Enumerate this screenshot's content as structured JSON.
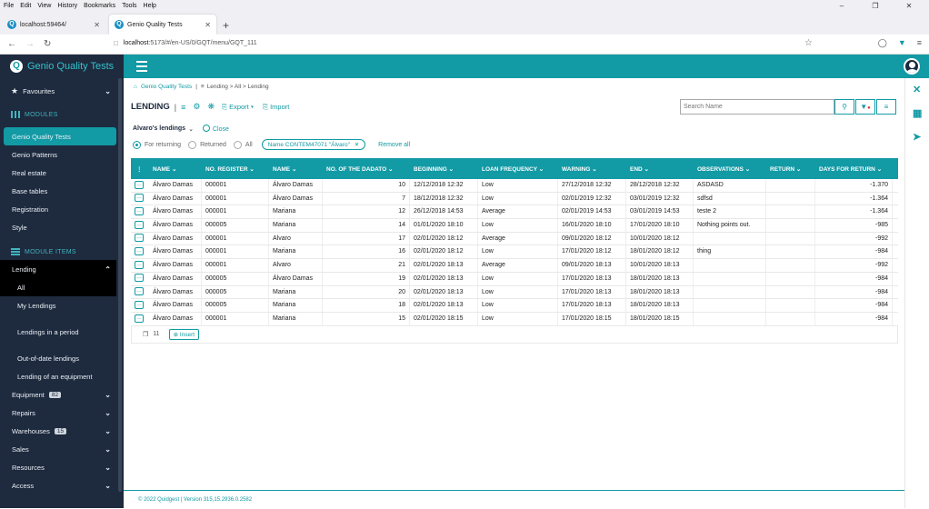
{
  "browser": {
    "menu": [
      "File",
      "Edit",
      "View",
      "History",
      "Bookmarks",
      "Tools",
      "Help"
    ],
    "tabs": [
      {
        "label": "localhost:59464/"
      },
      {
        "label": "Genio Quality Tests"
      }
    ],
    "url_host": "localhost",
    "url_rest": ":5173/#/en-US/0/GQT/menu/GQT_111"
  },
  "sidebar": {
    "brand": "Genio Quality Tests",
    "favourites": "Favourites",
    "modules_header": "MODULES",
    "modules": [
      "Genio Quality Tests",
      "Genio Patterns",
      "Real estate",
      "Base tables",
      "Registration",
      "Style"
    ],
    "module_items_header": "MODULE ITEMS",
    "lending": "Lending",
    "lending_sub": [
      "All",
      "My Lendings",
      "Lendings in a period",
      "Out-of-date lendings",
      "Lending of an equipment"
    ],
    "groups": [
      {
        "label": "Equipment",
        "badge": "82"
      },
      {
        "label": "Repairs",
        "badge": ""
      },
      {
        "label": "Warehouses",
        "badge": "15"
      },
      {
        "label": "Sales",
        "badge": ""
      },
      {
        "label": "Resources",
        "badge": ""
      },
      {
        "label": "Access",
        "badge": ""
      }
    ]
  },
  "breadcrumb": {
    "home": "Genio Quality Tests",
    "rest": "Lending > All > Lending"
  },
  "toolbar": {
    "title": "LENDING",
    "export_label": "Export",
    "import_label": "Import",
    "search_placeholder": "Search Name"
  },
  "subbar": {
    "label": "Alvaro's lendings",
    "close_label": "Close"
  },
  "filters": {
    "options": [
      "For returning",
      "Returned",
      "All"
    ],
    "chip": "Name CONTEM47071 \"Álvaro\"",
    "remove_all": "Remove all"
  },
  "table": {
    "columns": [
      "NAME",
      "NO. REGISTER",
      "NAME",
      "NO. OF THE DADATO",
      "BEGINNING",
      "LOAN FREQUENCY",
      "WARNING",
      "END",
      "OBSERVATIONS",
      "RETURN",
      "DAYS FOR RETURN"
    ],
    "rows": [
      [
        "Álvaro Damas",
        "000001",
        "Álvaro Damas",
        "10",
        "12/12/2018 12:32",
        "Low",
        "27/12/2018 12:32",
        "28/12/2018 12:32",
        "ASDASD",
        "",
        "-1.370"
      ],
      [
        "Álvaro Damas",
        "000001",
        "Álvaro Damas",
        "7",
        "18/12/2018 12:32",
        "Low",
        "02/01/2019 12:32",
        "03/01/2019 12:32",
        "sdfsd",
        "",
        "-1.364"
      ],
      [
        "Álvaro Damas",
        "000001",
        "Mariana",
        "12",
        "26/12/2018 14:53",
        "Average",
        "02/01/2019 14:53",
        "03/01/2019 14:53",
        "teste 2",
        "",
        "-1.364"
      ],
      [
        "Álvaro Damas",
        "000005",
        "Mariana",
        "14",
        "01/01/2020 18:10",
        "Low",
        "16/01/2020 18:10",
        "17/01/2020 18:10",
        "Nothing points out.",
        "",
        "-985"
      ],
      [
        "Álvaro Damas",
        "000001",
        "Alvaro",
        "17",
        "02/01/2020 18:12",
        "Average",
        "09/01/2020 18:12",
        "10/01/2020 18:12",
        "",
        "",
        "-992"
      ],
      [
        "Álvaro Damas",
        "000001",
        "Mariana",
        "16",
        "02/01/2020 18:12",
        "Low",
        "17/01/2020 18:12",
        "18/01/2020 18:12",
        "thing",
        "",
        "-984"
      ],
      [
        "Álvaro Damas",
        "000001",
        "Alvaro",
        "21",
        "02/01/2020 18:13",
        "Average",
        "09/01/2020 18:13",
        "10/01/2020 18:13",
        "",
        "",
        "-992"
      ],
      [
        "Álvaro Damas",
        "000005",
        "Álvaro Damas",
        "19",
        "02/01/2020 18:13",
        "Low",
        "17/01/2020 18:13",
        "18/01/2020 18:13",
        "",
        "",
        "-984"
      ],
      [
        "Álvaro Damas",
        "000005",
        "Mariana",
        "20",
        "02/01/2020 18:13",
        "Low",
        "17/01/2020 18:13",
        "18/01/2020 18:13",
        "",
        "",
        "-984"
      ],
      [
        "Álvaro Damas",
        "000005",
        "Mariana",
        "18",
        "02/01/2020 18:13",
        "Low",
        "17/01/2020 18:13",
        "18/01/2020 18:13",
        "",
        "",
        "-984"
      ],
      [
        "Álvaro Damas",
        "000001",
        "Mariana",
        "15",
        "02/01/2020 18:15",
        "Low",
        "17/01/2020 18:15",
        "18/01/2020 18:15",
        "",
        "",
        "-984"
      ]
    ],
    "count": "11",
    "insert_label": "Insert"
  },
  "footer": "© 2022 Quidgest | Version 315,15.2936.0.2582",
  "colors": {
    "accent": "#129aa5",
    "sidebar": "#1e2a3e"
  }
}
